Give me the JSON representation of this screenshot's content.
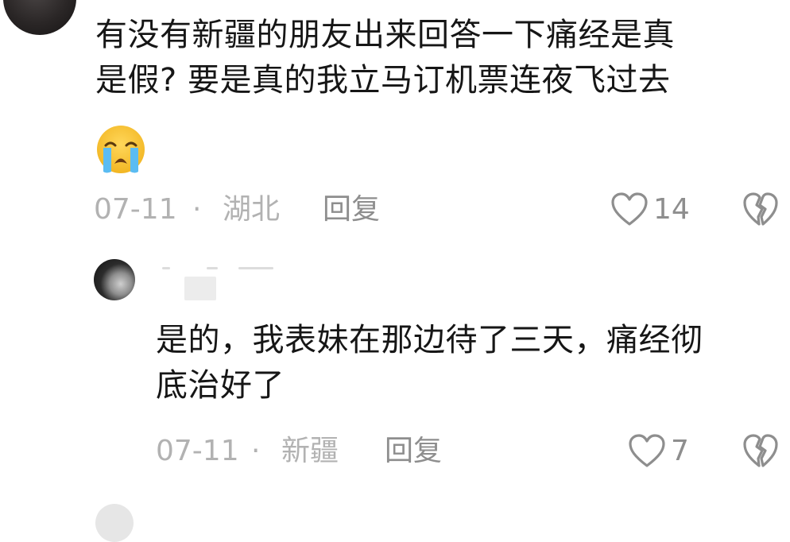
{
  "comments": [
    {
      "text_lines": [
        "有没有新疆的朋友出来回答一下痛经是真",
        "是假? 要是真的我立马订机票连夜飞过去"
      ],
      "emoji": "loudly-crying-face",
      "date": "07-11",
      "separator": "·",
      "location": "湖北",
      "reply_label": "回复",
      "like_count": "14"
    },
    {
      "text_lines": [
        "是的，我表妹在那边待了三天，痛经彻",
        "底治好了"
      ],
      "date": "07-11",
      "separator": "·",
      "location": "新疆",
      "reply_label": "回复",
      "like_count": "7"
    }
  ],
  "colors": {
    "text": "#161616",
    "meta": "#b2b2b2",
    "action": "#8e8e8e",
    "emoji_face": "#f7c43b"
  }
}
